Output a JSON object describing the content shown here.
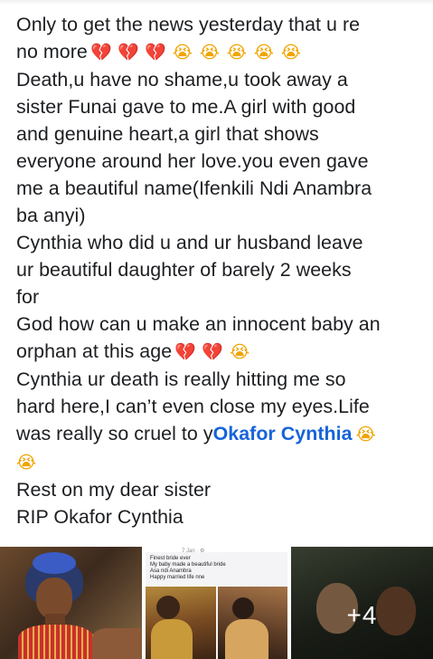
{
  "post": {
    "line1": "Only to get the news yesterday that u re",
    "line2_text": "no more",
    "line3": "Death,u have no shame,u took away a",
    "line4": "sister Funai gave to me.A girl with good",
    "line5": "and genuine heart,a girl that shows",
    "line6": "everyone around her love.you even gave",
    "line7": "me a beautiful name(Ifenkili Ndi Anambra",
    "line8": "ba anyi)",
    "line9": "Cynthia who did u and ur husband leave",
    "line10": "ur beautiful daughter of barely 2 weeks",
    "line11": "for",
    "line12": "God how can u make an innocent baby an",
    "line13_text": "orphan at this age",
    "line14": "Cynthia ur death is really hitting me so",
    "line15": "hard here,I can’t even close my eyes.Life",
    "line16_text": "was really so cruel to y",
    "mention": "Okafor Cynthia",
    "line18": "Rest on my dear sister",
    "line19": "RIP Okafor Cynthia"
  },
  "emoji": {
    "broken_heart": "💔",
    "crying_face": "😭"
  },
  "photos": {
    "photo2_meta": "7 Jan · ⚙",
    "photo2_caption": "Finest bride ever\nMy baby made a beautiful bride\nAsa ndi Anambra\nHappy married life nne",
    "more_count": "+4"
  },
  "colors": {
    "text": "#1c1e21",
    "mention": "#1664d9"
  }
}
